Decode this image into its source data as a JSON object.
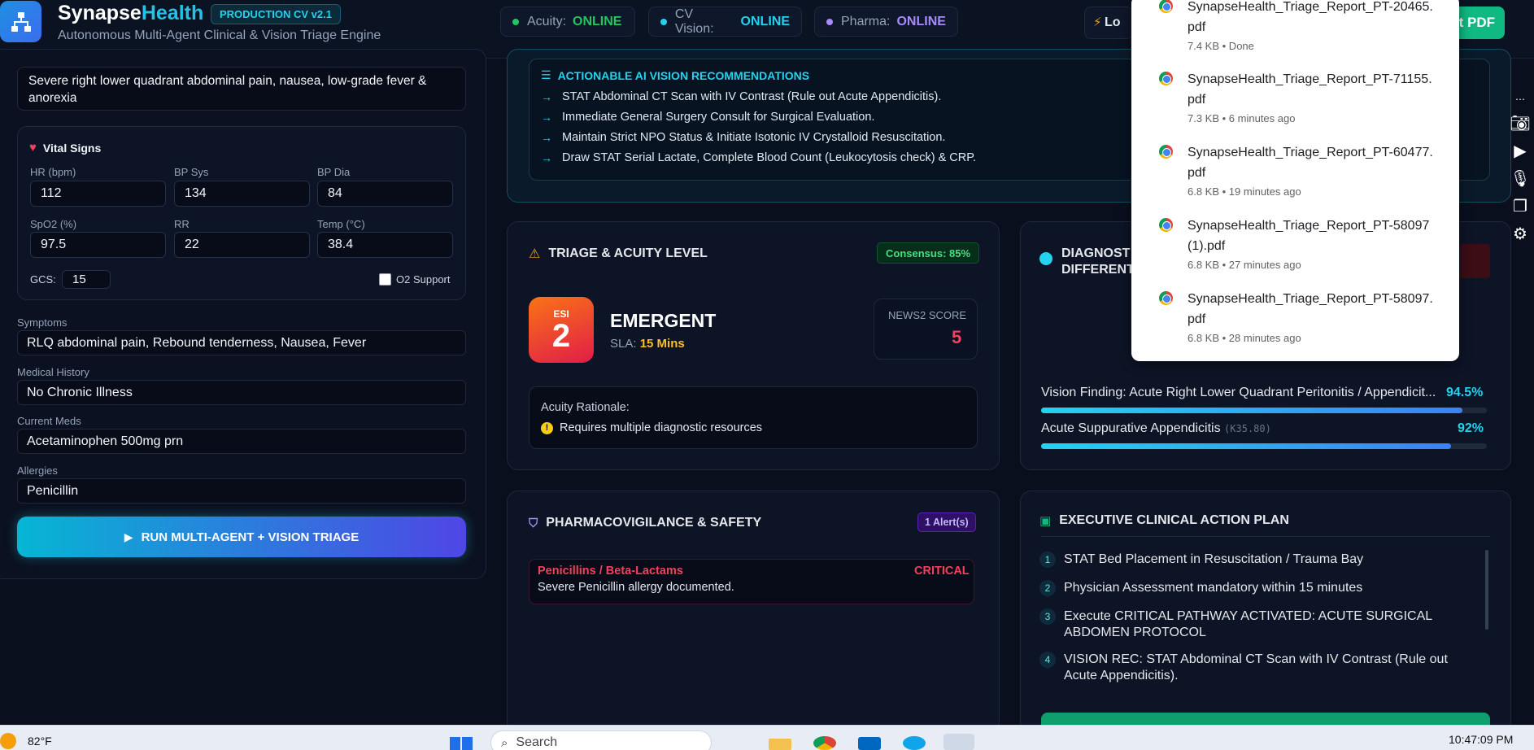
{
  "header": {
    "brand_part1": "Synapse",
    "brand_part2": "Health",
    "version_badge": "PRODUCTION CV v2.1",
    "subtitle": "Autonomous Multi-Agent Clinical & Vision Triage Engine",
    "agents": [
      {
        "label": "Acuity:",
        "status": "ONLINE",
        "color": "#22c55e"
      },
      {
        "label": "CV Vision:",
        "status": "ONLINE",
        "color": "#22d3ee"
      },
      {
        "label": "Pharma:",
        "status": "ONLINE",
        "color": "#a78bfa"
      }
    ],
    "load_label": "Lo",
    "export_label": "rt PDF"
  },
  "intake": {
    "chief_complaint": "Severe right lower quadrant abdominal pain, nausea, low-grade fever & anorexia",
    "vitals_title": "Vital Signs",
    "vitals": [
      {
        "label": "HR (bpm)",
        "value": "112"
      },
      {
        "label": "BP Sys",
        "value": "134"
      },
      {
        "label": "BP Dia",
        "value": "84"
      },
      {
        "label": "SpO2 (%)",
        "value": "97.5"
      },
      {
        "label": "RR",
        "value": "22"
      },
      {
        "label": "Temp (°C)",
        "value": "38.4"
      }
    ],
    "gcs_label": "GCS:",
    "gcs_value": "15",
    "o2_label": "O2 Support",
    "fields": [
      {
        "label": "Symptoms",
        "value": "RLQ abdominal pain, Rebound tenderness, Nausea, Fever"
      },
      {
        "label": "Medical History",
        "value": "No Chronic Illness"
      },
      {
        "label": "Current Meds",
        "value": "Acetaminophen 500mg prn"
      },
      {
        "label": "Allergies",
        "value": "Penicillin"
      }
    ],
    "run_button": "RUN MULTI-AGENT + VISION TRIAGE"
  },
  "vision_recs": {
    "title": "ACTIONABLE AI VISION RECOMMENDATIONS",
    "items": [
      "STAT Abdominal CT Scan with IV Contrast (Rule out Acute Appendicitis).",
      "Immediate General Surgery Consult for Surgical Evaluation.",
      "Maintain Strict NPO Status & Initiate Isotonic IV Crystalloid Resuscitation.",
      "Draw STAT Serial Lactate, Complete Blood Count (Leukocytosis check) & CRP."
    ]
  },
  "triage": {
    "title": "TRIAGE & ACUITY LEVEL",
    "consensus": "Consensus: 85%",
    "esi_label": "ESI",
    "esi_value": "2",
    "level": "EMERGENT",
    "sla_label": "SLA:",
    "sla_value": "15 Mins",
    "news_label": "NEWS2 SCORE",
    "news_value": "5",
    "rationale_title": "Acuity Rationale:",
    "rationale_item": "Requires multiple diagnostic resources"
  },
  "diagnostics": {
    "title_line1": "DIAGNOST",
    "title_line2": "DIFFERENT",
    "items": [
      {
        "name": "Vision Finding: Acute Right Lower Quadrant Peritonitis / Appendicit...",
        "code": "",
        "pct_label": "94.5%",
        "pct": 94.5
      },
      {
        "name": "Acute Suppurative Appendicitis",
        "code": "(K35.80)",
        "pct_label": "92%",
        "pct": 92
      }
    ]
  },
  "pharma": {
    "title": "PHARMACOVIGILANCE & SAFETY",
    "alert_badge": "1 Alert(s)",
    "alert_class": "Penicillins / Beta-Lactams",
    "alert_severity": "CRITICAL",
    "alert_desc": "Severe Penicillin allergy documented."
  },
  "plan": {
    "title": "EXECUTIVE CLINICAL ACTION PLAN",
    "items": [
      {
        "num": "1",
        "text": "STAT Bed Placement in Resuscitation / Trauma Bay"
      },
      {
        "num": "2",
        "text": "Physician Assessment mandatory within 15 minutes"
      },
      {
        "num": "3",
        "text": "Execute CRITICAL PATHWAY ACTIVATED: ACUTE SURGICAL ABDOMEN PROTOCOL"
      },
      {
        "num": "4",
        "text": "VISION REC: STAT Abdominal CT Scan with IV Contrast (Rule out Acute Appendicitis)."
      }
    ]
  },
  "downloads": [
    {
      "name": "SynapseHealth_Triage_Report_PT-20465.\npdf",
      "meta": "7.4 KB • Done"
    },
    {
      "name": "SynapseHealth_Triage_Report_PT-71155.\npdf",
      "meta": "7.3 KB • 6 minutes ago"
    },
    {
      "name": "SynapseHealth_Triage_Report_PT-60477.\npdf",
      "meta": "6.8 KB • 19 minutes ago"
    },
    {
      "name": "SynapseHealth_Triage_Report_PT-58097\n(1).pdf",
      "meta": "6.8 KB • 27 minutes ago"
    },
    {
      "name": "SynapseHealth_Triage_Report_PT-58097.\npdf",
      "meta": "6.8 KB • 28 minutes ago"
    }
  ],
  "taskbar": {
    "weather": "82°F",
    "search_placeholder": "Search",
    "clock": "10:47:09 PM"
  }
}
